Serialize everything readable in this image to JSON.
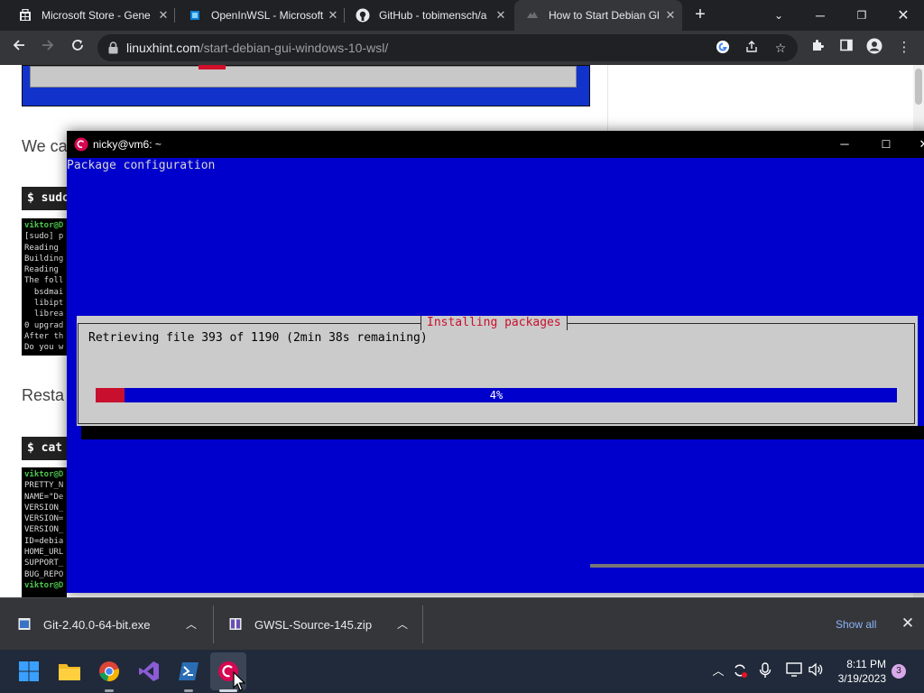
{
  "browser": {
    "tabs": [
      {
        "title": "Microsoft Store - Gene",
        "favicon": "microsoft-store-icon",
        "active": false
      },
      {
        "title": "OpenInWSL - Microsoft",
        "favicon": "openinwsl-icon",
        "active": false
      },
      {
        "title": "GitHub - tobimensch/a",
        "favicon": "github-icon",
        "active": false
      },
      {
        "title": "How to Start Debian Gl",
        "favicon": "linuxhint-icon",
        "active": true
      }
    ],
    "url_host": "linuxhint.com",
    "url_path": "/start-debian-gui-windows-10-wsl/"
  },
  "page": {
    "text_1": "We ca",
    "code_1": "$ sudo",
    "term_1": [
      "viktor@D",
      "[sudo] p",
      "Reading ",
      "Building",
      "Reading ",
      "The foll",
      "  bsdmai",
      "  libipt",
      "  librea",
      "0 upgrad",
      "After th",
      "Do you w"
    ],
    "text_2": "Resta",
    "code_2": "$ cat",
    "term_2": [
      "viktor@D",
      "PRETTY_N",
      "NAME=\"De",
      "VERSION_",
      "VERSION=",
      "VERSION_",
      "ID=debia",
      "HOME_URL",
      "SUPPORT_",
      "BUG_REPO",
      "viktor@D"
    ]
  },
  "terminal": {
    "window_title": "nicky@vm6: ~",
    "backtitle": "Package configuration",
    "dialog_title": "Installing packages",
    "message": "Retrieving file 393 of 1190 (2min 38s remaining)",
    "progress_percent": 4,
    "progress_label": "4%"
  },
  "downloads": {
    "items": [
      {
        "filename": "Git-2.40.0-64-bit.exe"
      },
      {
        "filename": "GWSL-Source-145.zip"
      }
    ],
    "show_all": "Show all"
  },
  "taskbar": {
    "time": "8:11 PM",
    "date": "3/19/2023",
    "notification_count": "3"
  },
  "colors": {
    "dialog_blue": "#0000cc",
    "dialog_red": "#c8102e",
    "link_blue": "#8ab4f8"
  }
}
